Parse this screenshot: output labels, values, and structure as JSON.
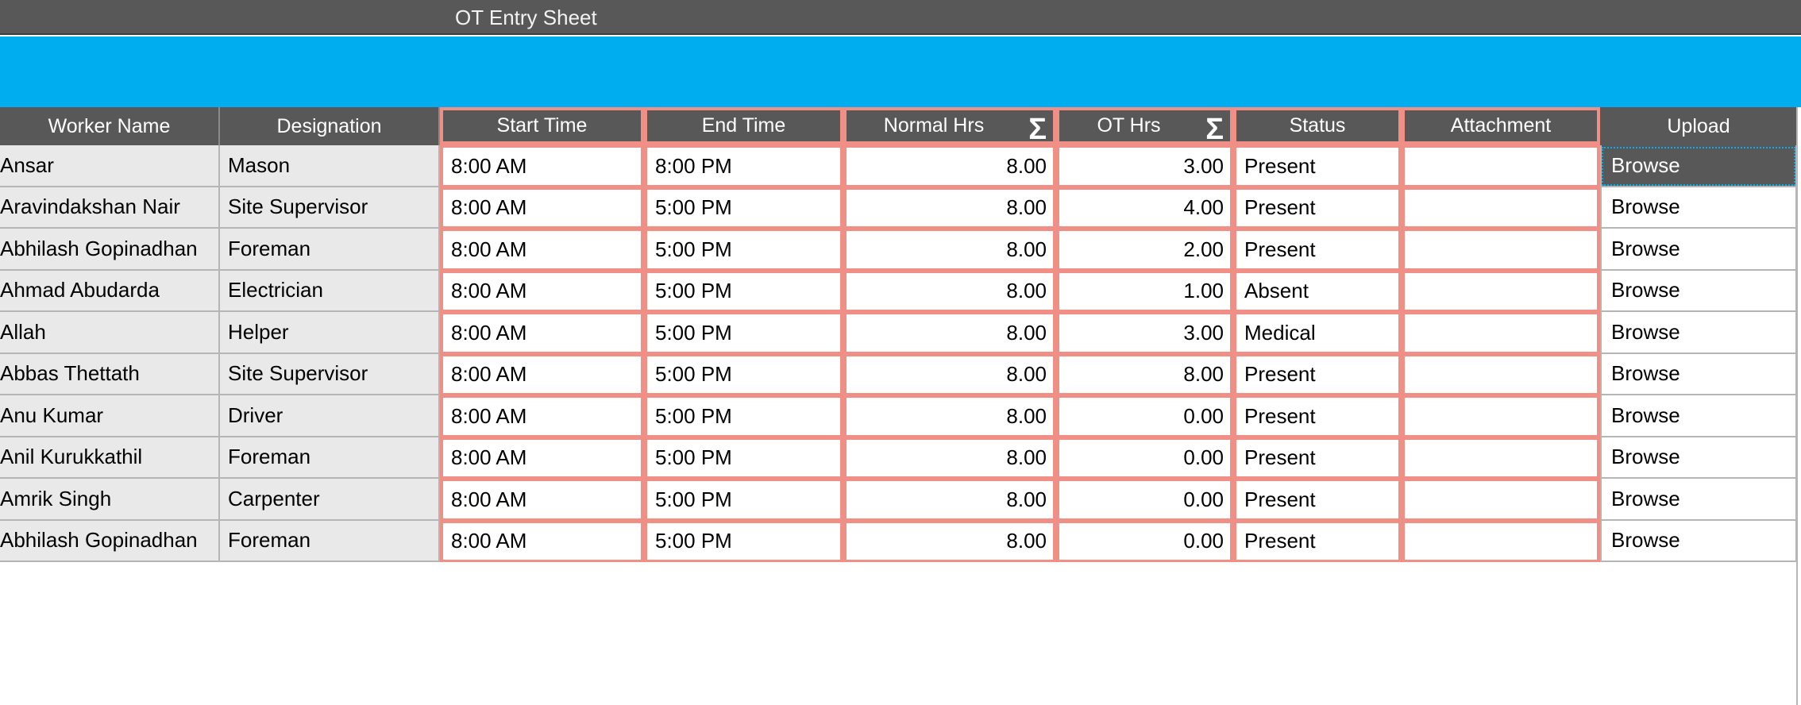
{
  "window": {
    "title": "OT Entry Sheet"
  },
  "columns": {
    "worker_name": "Worker Name",
    "designation": "Designation",
    "start_time": "Start Time",
    "end_time": "End Time",
    "normal_hrs": "Normal Hrs",
    "ot_hrs": "OT Hrs",
    "status": "Status",
    "attachment": "Attachment",
    "upload": "Upload"
  },
  "sum_glyph": "Σ",
  "rows": [
    {
      "worker_name": "Ansar",
      "designation": "Mason",
      "start_time": "8:00 AM",
      "end_time": "8:00 PM",
      "normal_hrs": "8.00",
      "ot_hrs": "3.00",
      "status": "Present",
      "attachment": "",
      "upload": "Browse"
    },
    {
      "worker_name": "Aravindakshan Nair",
      "designation": "Site Supervisor",
      "start_time": "8:00 AM",
      "end_time": "5:00 PM",
      "normal_hrs": "8.00",
      "ot_hrs": "4.00",
      "status": "Present",
      "attachment": "",
      "upload": "Browse"
    },
    {
      "worker_name": "Abhilash Gopinadhan",
      "designation": "Foreman",
      "start_time": "8:00 AM",
      "end_time": "5:00 PM",
      "normal_hrs": "8.00",
      "ot_hrs": "2.00",
      "status": "Present",
      "attachment": "",
      "upload": "Browse"
    },
    {
      "worker_name": "Ahmad Abudarda",
      "designation": "Electrician",
      "start_time": "8:00 AM",
      "end_time": "5:00 PM",
      "normal_hrs": "8.00",
      "ot_hrs": "1.00",
      "status": "Absent",
      "attachment": "",
      "upload": "Browse"
    },
    {
      "worker_name": "Allah",
      "designation": "Helper",
      "start_time": "8:00 AM",
      "end_time": "5:00 PM",
      "normal_hrs": "8.00",
      "ot_hrs": "3.00",
      "status": "Medical",
      "attachment": "",
      "upload": "Browse"
    },
    {
      "worker_name": "Abbas Thettath",
      "designation": "Site Supervisor",
      "start_time": "8:00 AM",
      "end_time": "5:00 PM",
      "normal_hrs": "8.00",
      "ot_hrs": "8.00",
      "status": "Present",
      "attachment": "",
      "upload": "Browse"
    },
    {
      "worker_name": "Anu Kumar",
      "designation": "Driver",
      "start_time": "8:00 AM",
      "end_time": "5:00 PM",
      "normal_hrs": "8.00",
      "ot_hrs": "0.00",
      "status": "Present",
      "attachment": "",
      "upload": "Browse"
    },
    {
      "worker_name": "Anil Kurukkathil",
      "designation": "Foreman",
      "start_time": "8:00 AM",
      "end_time": "5:00 PM",
      "normal_hrs": "8.00",
      "ot_hrs": "0.00",
      "status": "Present",
      "attachment": "",
      "upload": "Browse"
    },
    {
      "worker_name": "Amrik Singh",
      "designation": "Carpenter",
      "start_time": "8:00 AM",
      "end_time": "5:00 PM",
      "normal_hrs": "8.00",
      "ot_hrs": "0.00",
      "status": "Present",
      "attachment": "",
      "upload": "Browse"
    },
    {
      "worker_name": "Abhilash Gopinadhan",
      "designation": "Foreman",
      "start_time": "8:00 AM",
      "end_time": "5:00 PM",
      "normal_hrs": "8.00",
      "ot_hrs": "0.00",
      "status": "Present",
      "attachment": "",
      "upload": "Browse"
    }
  ],
  "colors": {
    "header_bg": "#585858",
    "accent_band": "#00adee",
    "editable_border": "#f08f86",
    "readonly_bg": "#e9e9e9"
  }
}
